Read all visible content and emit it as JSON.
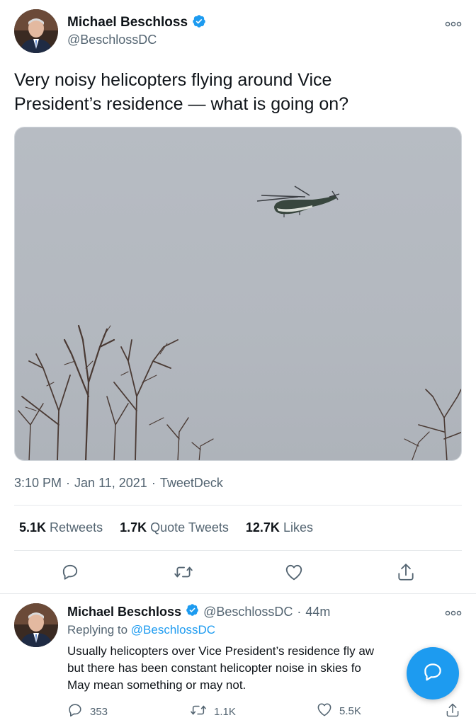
{
  "main_tweet": {
    "author_name": "Michael Beschloss",
    "author_handle": "@BeschlossDC",
    "text": "Very noisy helicopters flying around Vice President’s residence — what is going on?",
    "media_alt": "Helicopter flying in grey sky above bare trees",
    "time": "3:10 PM",
    "sep1": "·",
    "date": "Jan 11, 2021",
    "sep2": "·",
    "source": "TweetDeck",
    "stats": {
      "retweets_num": "5.1K",
      "retweets_label": "Retweets",
      "quotes_num": "1.7K",
      "quotes_label": "Quote Tweets",
      "likes_num": "12.7K",
      "likes_label": "Likes"
    },
    "more_icon": "more-dots-icon",
    "actions": [
      "reply-icon",
      "retweet-icon",
      "like-icon",
      "share-icon"
    ]
  },
  "reply_tweet": {
    "author_name": "Michael Beschloss",
    "author_handle": "@BeschlossDC",
    "sep": "·",
    "time_ago": "44m",
    "replying_prefix": "Replying to",
    "replying_handle": "@BeschlossDC",
    "line1": "Usually helicopters over Vice President’s residence fly aw",
    "line2": "but there has been constant helicopter noise in skies fo",
    "line3": "May mean something or may not.",
    "counts": {
      "replies": "353",
      "retweets": "1.1K",
      "likes": "5.5K"
    }
  },
  "colors": {
    "accent": "#1d9bf0",
    "text": "#0f1419",
    "muted": "#536471"
  }
}
